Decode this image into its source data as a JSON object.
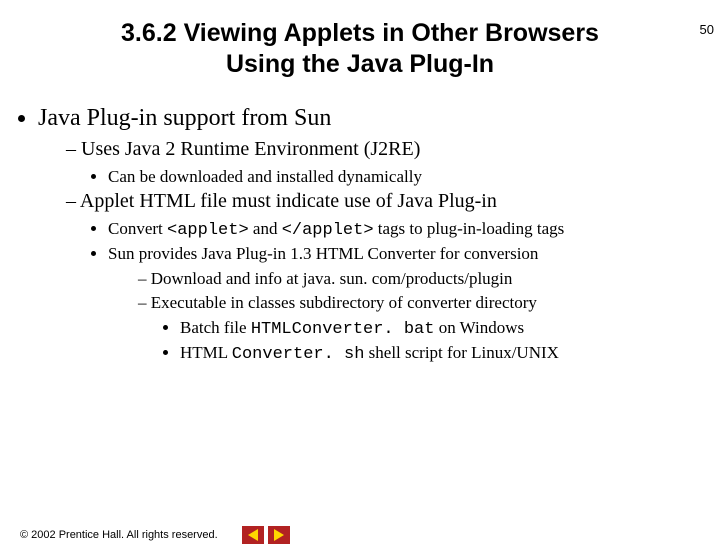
{
  "page_number": "50",
  "title_line1": "3.6.2  Viewing Applets in Other Browsers",
  "title_line2": "Using the Java Plug-In",
  "b1": "Java Plug-in support from Sun",
  "b1_1": "Uses Java 2 Runtime Environment (J2RE)",
  "b1_1_1": "Can be downloaded and installed dynamically",
  "b1_2": "Applet HTML file must indicate use of Java Plug-in",
  "b1_2_1_pre": "Convert ",
  "b1_2_1_code1": "<applet>",
  "b1_2_1_mid": " and ",
  "b1_2_1_code2": "</applet>",
  "b1_2_1_post": " tags to plug-in-loading tags",
  "b1_2_2": "Sun provides Java Plug-in 1.3 HTML Converter for conversion",
  "b1_2_2_1": "Download and info at java. sun. com/products/plugin",
  "b1_2_2_2": "Executable in classes subdirectory of converter directory",
  "b1_2_2_2_1_pre": "Batch file ",
  "b1_2_2_2_1_code": "HTMLConverter. bat",
  "b1_2_2_2_1_post": " on Windows",
  "b1_2_2_2_2_pre": "HTML ",
  "b1_2_2_2_2_code": "Converter. sh",
  "b1_2_2_2_2_post": " shell script for Linux/UNIX",
  "copyright": "© 2002 Prentice Hall. All rights reserved."
}
